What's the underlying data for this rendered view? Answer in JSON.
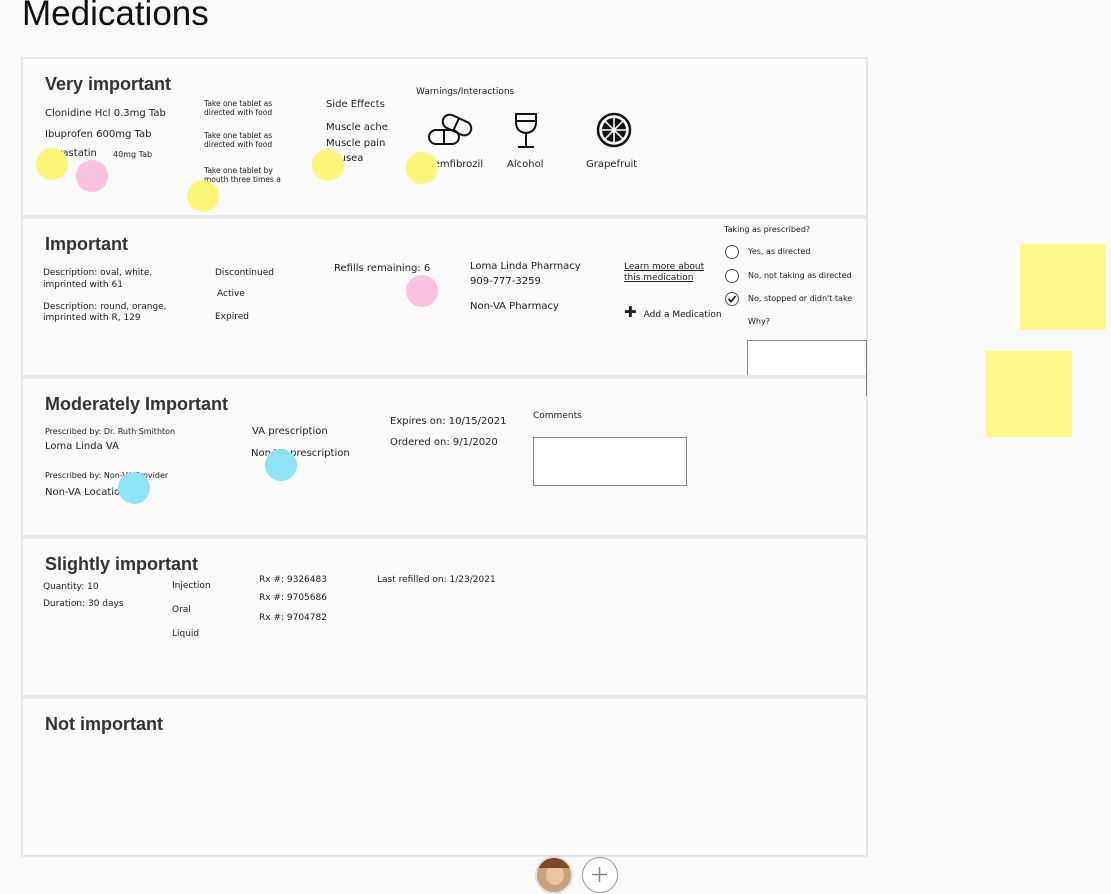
{
  "page_title": "Medications",
  "sections": {
    "very_important": {
      "title": "Very important",
      "meds": [
        "Clonidine Hcl 0.3mg Tab",
        "Ibuprofen 600mg Tab",
        "Lovastatin",
        "40mg Tab"
      ],
      "instructions": [
        [
          "Take one tablet as",
          "directed with food"
        ],
        [
          "Take one tablet as",
          "directed with food"
        ],
        [
          "Take one tablet by",
          "mouth three times a"
        ]
      ],
      "side_effects_label": "Side Effects",
      "side_effects": [
        "Muscle ache",
        "Muscle pain",
        "Nausea"
      ],
      "warnings_label": "Warnings/Interactions",
      "warnings": [
        "Gemfibrozil",
        "Alcohol",
        "Grapefruit"
      ]
    },
    "important": {
      "title": "Important",
      "descriptions": [
        [
          "Description: oval, white,",
          "imprinted with 61"
        ],
        [
          "Description: round, orange,",
          "imprinted with R, 129"
        ]
      ],
      "statuses": [
        "Discontinued",
        "Active",
        "Expired"
      ],
      "refills": "Refills remaining: 6",
      "pharmacy_name": "Loma Linda Pharmacy",
      "pharmacy_phone": "909-777-3259",
      "non_va_pharmacy": "Non-VA Pharmacy",
      "learn_more": [
        "Learn more about",
        "this medication"
      ],
      "add_medication": "Add a Medication",
      "taking_label": "Taking as prescribed?",
      "options": [
        "Yes, as directed",
        "No, not taking as directed",
        "No, stopped or didn't take"
      ],
      "why_label": "Why?"
    },
    "moderately_important": {
      "title": "Moderately Important",
      "prescribed_by_1": "Prescribed by: Dr. Ruth Smithton",
      "location_1": "Loma Linda VA",
      "prescribed_by_2": "Prescribed by: Non-VA Provider",
      "location_2": "Non-VA Location",
      "rx_types": [
        "VA prescription",
        "Non-VA prescription"
      ],
      "expires": "Expires on: 10/15/2021",
      "ordered": "Ordered on: 9/1/2020",
      "comments_label": "Comments"
    },
    "slightly_important": {
      "title": "Slightly important",
      "quantity": "Quantity: 10",
      "duration": "Duration: 30 days",
      "routes": [
        "Injection",
        "Oral",
        "Liquid"
      ],
      "rx_numbers": [
        "Rx #: 9326483",
        "Rx #: 9705686",
        "Rx #: 9704782"
      ],
      "last_refilled": "Last refilled on: 1/23/2021"
    },
    "not_important": {
      "title": "Not important"
    }
  },
  "colors": {
    "yellow_dot": "#fbf77a",
    "pink_dot": "#f9c2de",
    "blue_dot": "#8ee4f5",
    "sticky_note": "#fdf98a"
  }
}
